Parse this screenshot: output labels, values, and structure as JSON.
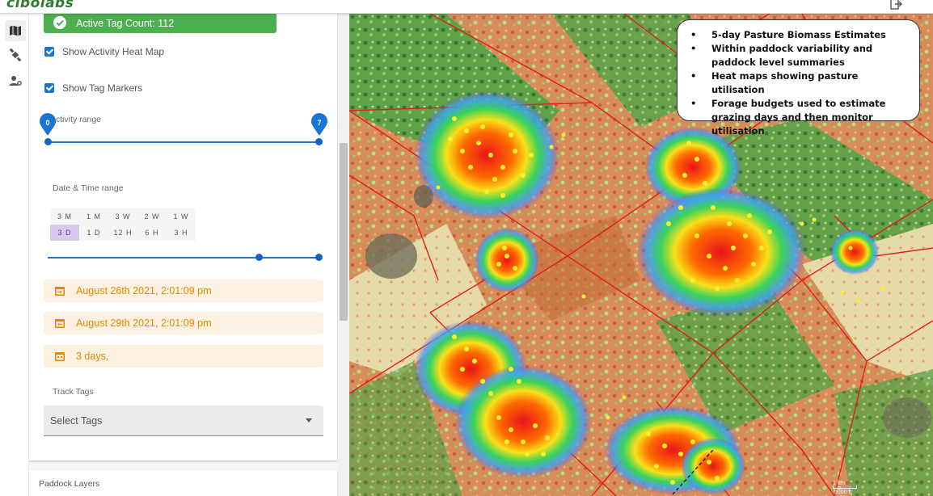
{
  "app": {
    "logo_main": "cibolabs",
    "logo_accent": ""
  },
  "topbar": {
    "exit_icon": "exit-icon"
  },
  "rail": {
    "items": [
      {
        "icon": "map-icon",
        "active": true
      },
      {
        "icon": "satellite-icon",
        "active": false
      },
      {
        "icon": "user-settings-icon",
        "active": false
      }
    ]
  },
  "panel": {
    "active_tag_label": "Active Tag Count: 112",
    "show_heat_map": "Show Activity Heat Map",
    "show_tag_markers": "Show Tag Markers",
    "activity_range_label": "Activity range",
    "activity_min": "0",
    "activity_max": "7",
    "date_time_label": "Date & Time range",
    "range_options_row1": [
      "3 M",
      "1 M",
      "3 W",
      "2 W",
      "1 W"
    ],
    "range_options_row2": [
      "3 D",
      "1 D",
      "12 H",
      "6 H",
      "3 H"
    ],
    "range_selected": "3 D",
    "start_date": "August 26th 2021, 2:01:09 pm",
    "end_date": "August 29th 2021, 2:01:09 pm",
    "duration": "3 days,",
    "track_tags_label": "Track Tags",
    "select_tags_placeholder": "Select Tags",
    "paddock_layers_label": "Paddock Layers"
  },
  "info_box": {
    "bullets": [
      "5-day Pasture Biomass Estimates",
      "Within paddock variability and paddock level summaries",
      "Heat maps showing pasture utilisation",
      "Forage budgets used to estimate grazing days and then monitor utilisation"
    ]
  },
  "map": {
    "scale_km": "1 km",
    "scale_ft": "5000 ft"
  },
  "colors": {
    "accent_blue": "#1976d2",
    "active_green": "#4caf50",
    "date_orange": "#e08a00",
    "paddock_red": "#e53935"
  }
}
